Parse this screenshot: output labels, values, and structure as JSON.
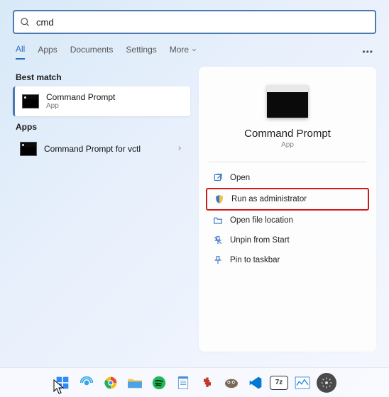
{
  "search": {
    "value": "cmd"
  },
  "tabs": {
    "all": "All",
    "apps": "Apps",
    "documents": "Documents",
    "settings": "Settings",
    "more": "More"
  },
  "sections": {
    "best_match": "Best match",
    "apps": "Apps"
  },
  "results": {
    "best": {
      "title": "Command Prompt",
      "sub": "App"
    },
    "app1": {
      "title": "Command Prompt for vctl"
    }
  },
  "preview": {
    "title": "Command Prompt",
    "sub": "App"
  },
  "actions": {
    "open": "Open",
    "run_admin": "Run as administrator",
    "open_loc": "Open file location",
    "unpin_start": "Unpin from Start",
    "pin_taskbar": "Pin to taskbar"
  }
}
